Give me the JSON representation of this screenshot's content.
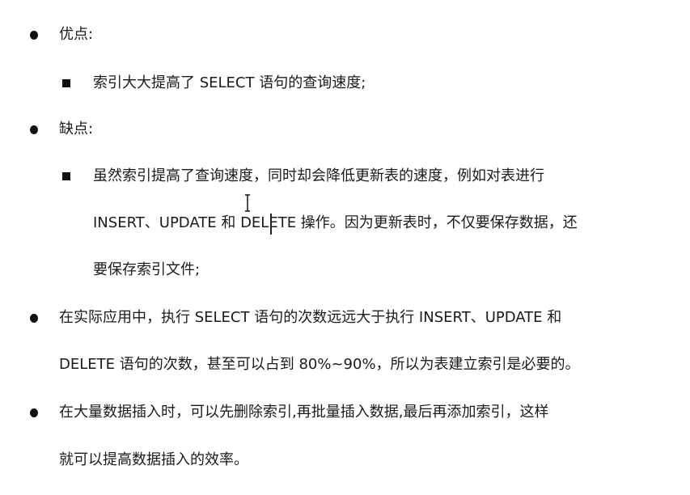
{
  "items": [
    {
      "type": "bullet",
      "lines": [
        "优点:"
      ]
    },
    {
      "type": "sub",
      "lines": [
        "索引大大提高了 SELECT 语句的查询速度;"
      ]
    },
    {
      "type": "bullet",
      "lines": [
        "缺点:"
      ]
    },
    {
      "type": "sub",
      "lines": [
        "虽然索引提高了查询速度，同时却会降低更新表的速度，例如对表进行",
        "INSERT、UPDATE 和 DELETE 操作。因为更新表时，不仅要保存数据，还",
        "要保存索引文件;"
      ]
    },
    {
      "type": "bullet",
      "lines": [
        "在实际应用中，执行 SELECT 语句的次数远远大于执行 INSERT、UPDATE 和",
        "DELETE 语句的次数，甚至可以占到 80%~90%，所以为表建立索引是必要的。"
      ]
    },
    {
      "type": "bullet",
      "lines": [
        "在大量数据插入时，可以先删除索引,再批量插入数据,最后再添加索引，这样",
        "就可以提高数据插入的效率。"
      ]
    }
  ]
}
